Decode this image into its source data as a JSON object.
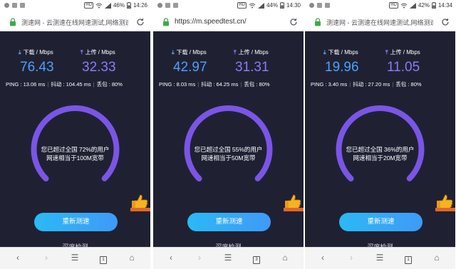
{
  "panels": [
    {
      "status": {
        "hd": "HD",
        "battery_pct": "46%",
        "time": "14:26"
      },
      "url": "测速网 - 云测速在线网速测试,网络测速",
      "download_label": "下载 / Mbps",
      "upload_label": "上传 / Mbps",
      "download": "76.43",
      "upload": "32.33",
      "ping": "PING : 13.06 ms",
      "jitter": "抖动 : 104.45 ms",
      "loss": "丢包 : 80%",
      "gauge_line1": "您已超过全国 72%的用户",
      "gauge_line2": "网速相当于100M宽带",
      "gauge_fraction": 0.72,
      "retest": "重新测速",
      "deep_check": "深度检测",
      "tabs_count": "1"
    },
    {
      "status": {
        "hd": "HD",
        "battery_pct": "44%",
        "time": "14:30"
      },
      "url": "https://m.speedtest.cn/",
      "download_label": "下载 / Mbps",
      "upload_label": "上传 / Mbps",
      "download": "42.97",
      "upload": "31.31",
      "ping": "PING : 8.03 ms",
      "jitter": "抖动 : 64.25 ms",
      "loss": "丢包 : 80%",
      "gauge_line1": "您已超过全国 55%的用户",
      "gauge_line2": "网速相当于50M宽带",
      "gauge_fraction": 0.55,
      "retest": "重新测速",
      "deep_check": "深度检测",
      "tabs_count": "3"
    },
    {
      "status": {
        "hd": "HD",
        "battery_pct": "42%",
        "time": "14:34"
      },
      "url": "测速网 - 云测速在线网速测试,网络测速",
      "download_label": "下载 / Mbps",
      "upload_label": "上传 / Mbps",
      "download": "19.96",
      "upload": "11.05",
      "ping": "PING : 3.40 ms",
      "jitter": "抖动 : 27.20 ms",
      "loss": "丢包 : 80%",
      "gauge_line1": "您已超过全国 36%的用户",
      "gauge_line2": "网速相当于20M宽带",
      "gauge_fraction": 0.36,
      "retest": "重新测速",
      "deep_check": "深度检测",
      "tabs_count": "1"
    }
  ],
  "icons": {
    "lock": "lock-icon",
    "reload": "reload-icon",
    "download": "download-arrow-icon",
    "upload": "upload-arrow-icon",
    "thumb": "thumbs-up-icon",
    "back": "back-icon",
    "forward": "forward-icon",
    "menu": "menu-icon",
    "tabs": "tabs-icon",
    "home": "home-icon"
  },
  "colors": {
    "background": "#1f2133",
    "download": "#4ca0ff",
    "upload": "#8b7bf7",
    "gauge_arc": "#7b55e6",
    "button": "#2bb9f5"
  }
}
